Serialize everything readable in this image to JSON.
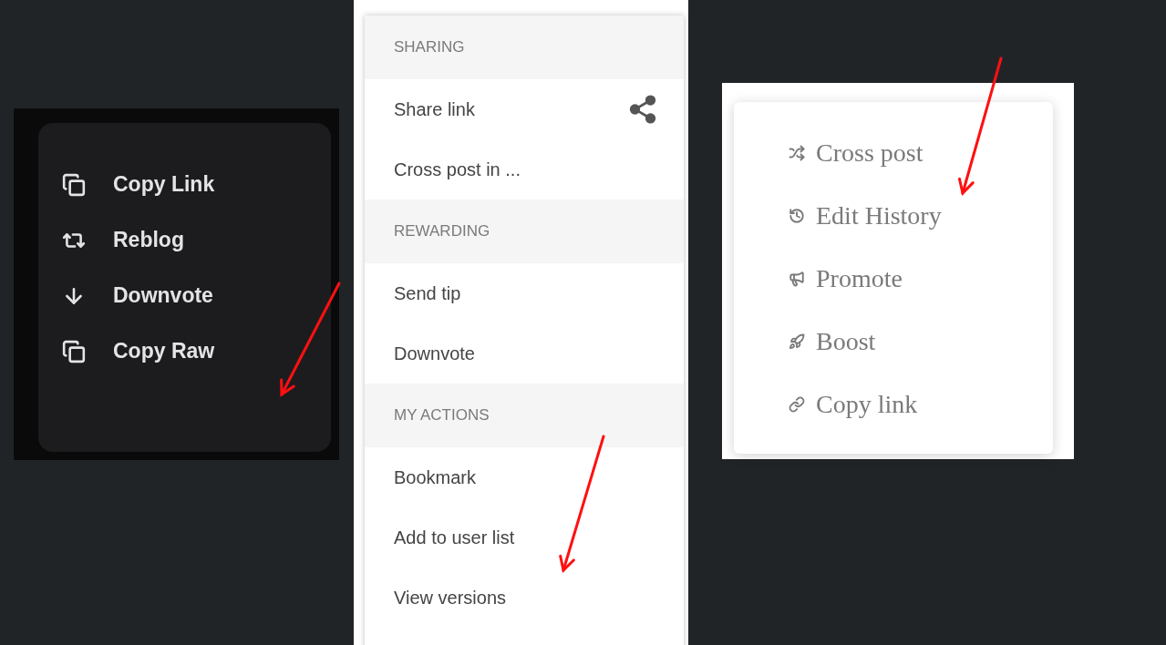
{
  "panels": [
    {
      "kind": "dark_menu",
      "items": [
        "Copy Link",
        "Reblog",
        "Downvote",
        "Copy Raw"
      ]
    },
    {
      "kind": "sectioned_menu",
      "sections": [
        {
          "header": "SHARING",
          "items": [
            "Share link",
            "Cross post in ..."
          ]
        },
        {
          "header": "REWARDING",
          "items": [
            "Send tip",
            "Downvote"
          ]
        },
        {
          "header": "MY ACTIONS",
          "items": [
            "Bookmark",
            "Add to user list",
            "View versions"
          ]
        }
      ]
    },
    {
      "kind": "serif_menu",
      "items": [
        "Cross post",
        "Edit History",
        "Promote",
        "Boost",
        "Copy link"
      ]
    }
  ]
}
